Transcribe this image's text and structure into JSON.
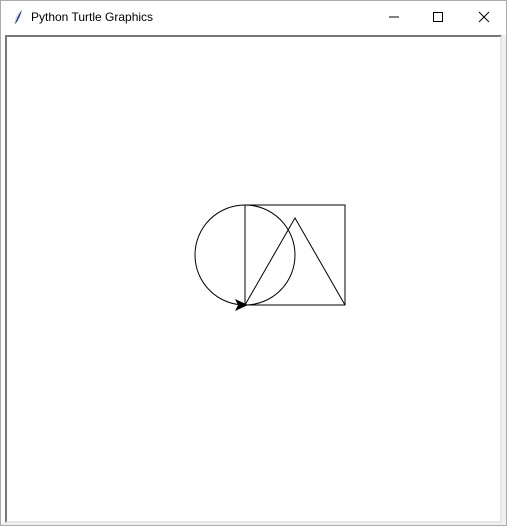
{
  "window": {
    "title": "Python Turtle Graphics",
    "icon": "feather-icon"
  },
  "controls": {
    "minimize": "minimize-icon",
    "maximize": "maximize-icon",
    "close": "close-icon"
  },
  "canvas": {
    "background": "#ffffff",
    "stroke": "#000000",
    "turtle_heading": "east"
  }
}
